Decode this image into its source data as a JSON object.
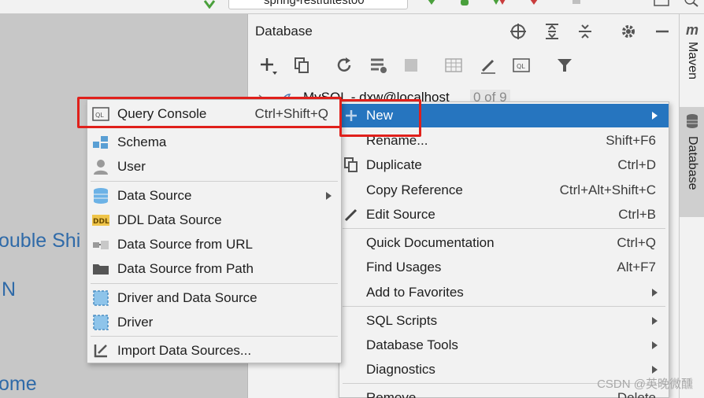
{
  "toolbar": {
    "run_config": "spring-restfultest00"
  },
  "editor_hints": [
    {
      "text": "ouble Shi"
    },
    {
      "text": "N"
    },
    {
      "text": "ome"
    }
  ],
  "db_panel": {
    "title": "Database",
    "tree": {
      "connection": "MySQL - dxw@localhost",
      "count": "0 of 9"
    }
  },
  "right_strip": {
    "maven_label": "Maven",
    "database_label": "Database"
  },
  "context_menu": {
    "new": "New",
    "rename": "Rename...",
    "rename_sc": "Shift+F6",
    "duplicate": "Duplicate",
    "duplicate_sc": "Ctrl+D",
    "copy_ref": "Copy Reference",
    "copy_ref_sc": "Ctrl+Alt+Shift+C",
    "edit_source": "Edit Source",
    "edit_source_sc": "Ctrl+B",
    "quick_doc": "Quick Documentation",
    "quick_doc_sc": "Ctrl+Q",
    "find_usages": "Find Usages",
    "find_usages_sc": "Alt+F7",
    "add_fav": "Add to Favorites",
    "sql_scripts": "SQL Scripts",
    "db_tools": "Database Tools",
    "diagnostics": "Diagnostics",
    "remove": "Remove",
    "remove_sc": "Delete"
  },
  "submenu": {
    "query_console": "Query Console",
    "query_console_sc": "Ctrl+Shift+Q",
    "schema": "Schema",
    "user": "User",
    "data_source": "Data Source",
    "ddl_data_source": "DDL Data Source",
    "ds_url": "Data Source from URL",
    "ds_path": "Data Source from Path",
    "driver_ds": "Driver and Data Source",
    "driver": "Driver",
    "import_ds": "Import Data Sources..."
  },
  "watermark": "CSDN @英晚微醺",
  "colors": {
    "highlight": "#2675bf",
    "annotation_red": "#e0201b",
    "hint_blue": "#2f6aa8"
  }
}
